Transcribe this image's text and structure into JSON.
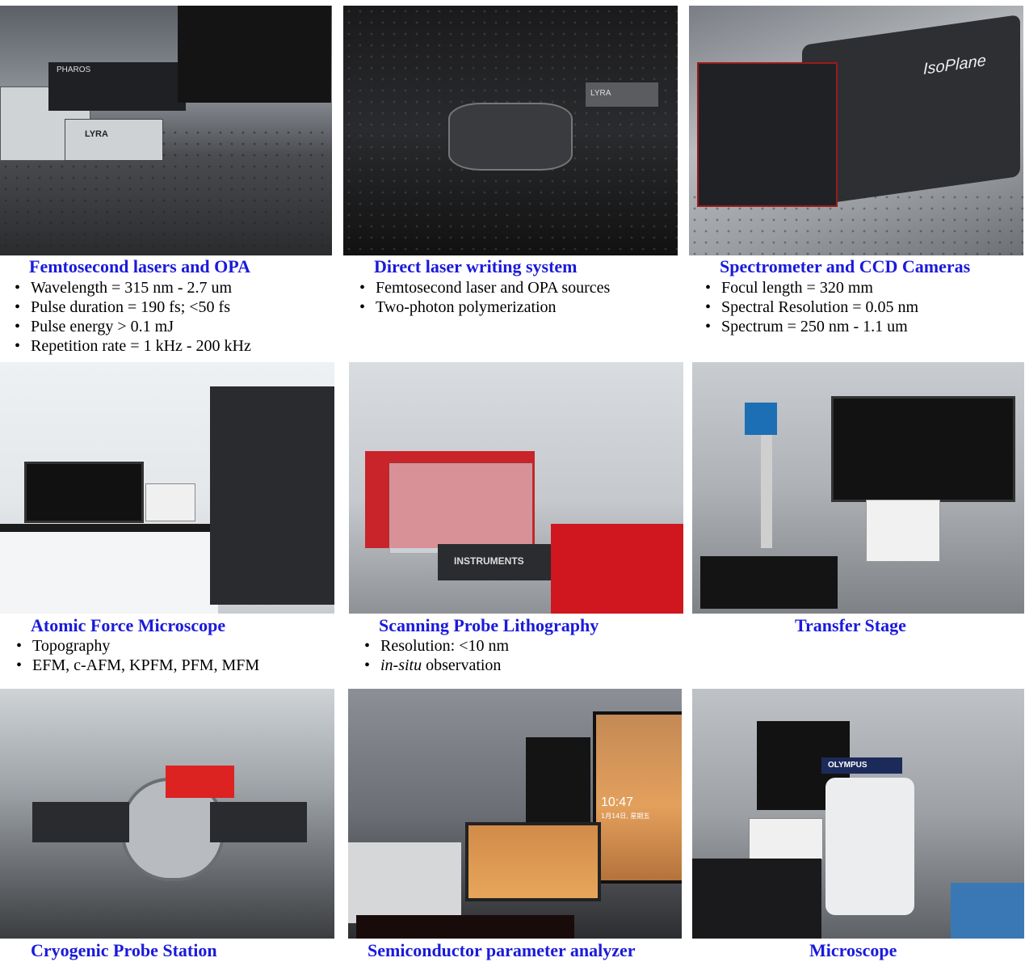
{
  "items": [
    {
      "title": "Femtosecond lasers and OPA",
      "specs": [
        "Wavelength  = 315 nm - 2.7 um",
        "Pulse duration = 190 fs; <50 fs",
        "Pulse energy > 0.1 mJ",
        "Repetition rate = 1 kHz - 200 kHz"
      ],
      "photo_text": [
        "PHAROS",
        "LYRA"
      ]
    },
    {
      "title": "Direct laser writing system",
      "specs": [
        "Femtosecond laser and OPA sources",
        "Two-photon polymerization"
      ],
      "photo_text": [
        "LYRA"
      ]
    },
    {
      "title": "Spectrometer and CCD Cameras",
      "specs": [
        "Focul length = 320 mm",
        "Spectral Resolution = 0.05 nm",
        "Spectrum = 250 nm - 1.1 um"
      ],
      "photo_text": [
        "IsoPlane"
      ]
    },
    {
      "title": "Atomic Force Microscope",
      "specs": [
        "Topography",
        "EFM, c-AFM, KPFM, PFM, MFM"
      ]
    },
    {
      "title": "Scanning Probe Lithography",
      "specs_parts": [
        {
          "text": "Resolution: <10 nm"
        },
        {
          "italic": "in-situ",
          "rest": " observation"
        }
      ],
      "photo_text": [
        "INSTRUMENTS"
      ]
    },
    {
      "title": "Transfer Stage",
      "specs": []
    },
    {
      "title": "Cryogenic Probe Station",
      "specs": []
    },
    {
      "title": "Semiconductor parameter analyzer",
      "specs": [],
      "photo_text": [
        "10:47",
        "1月14日, 星期五"
      ]
    },
    {
      "title": "Microscope",
      "specs": [],
      "photo_text": [
        "OLYMPUS"
      ]
    }
  ],
  "colors": {
    "title": "#1a1adb",
    "text": "#000000",
    "background": "#ffffff"
  }
}
